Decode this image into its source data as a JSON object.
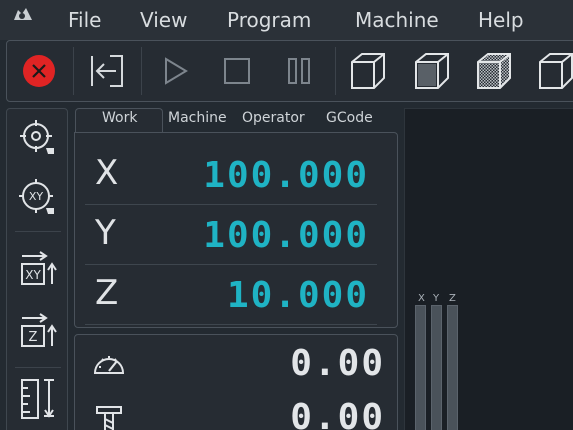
{
  "menu": {
    "items": [
      {
        "label": "File"
      },
      {
        "label": "View"
      },
      {
        "label": "Program"
      },
      {
        "label": "Machine"
      },
      {
        "label": "Help"
      }
    ]
  },
  "toolbar": {
    "buttons": [
      {
        "icon": "estop-icon"
      },
      {
        "icon": "exit-icon"
      },
      {
        "icon": "play-icon"
      },
      {
        "icon": "stop-icon"
      },
      {
        "icon": "pause-icon"
      },
      {
        "icon": "view-cube-icon"
      },
      {
        "icon": "view-cube-front-icon"
      },
      {
        "icon": "view-cube-shaded-icon"
      },
      {
        "icon": "view-cube-side-icon"
      }
    ],
    "estop_color": "#e02424"
  },
  "left_toolbar": {
    "buttons": [
      {
        "icon": "touch-off-probe-icon"
      },
      {
        "icon": "xy-probe-icon",
        "text": "XY"
      },
      {
        "icon": "zero-xy-icon",
        "text": "XY"
      },
      {
        "icon": "zero-z-icon",
        "text": "Z"
      },
      {
        "icon": "tool-length-icon"
      }
    ]
  },
  "dro": {
    "tabs": [
      {
        "label": "Work",
        "active": true
      },
      {
        "label": "Machine"
      },
      {
        "label": "Operator"
      },
      {
        "label": "GCode"
      }
    ],
    "axes": [
      {
        "label": "X",
        "value": "100.000"
      },
      {
        "label": "Y",
        "value": "100.000"
      },
      {
        "label": "Z",
        "value": "10.000"
      }
    ],
    "value_color": "#1fb3c4"
  },
  "status": {
    "feed": {
      "icon": "speedometer-icon",
      "value": "0.00"
    },
    "spindle": {
      "icon": "spindle-icon",
      "value": "0.00"
    }
  },
  "viewport": {
    "bar_labels": [
      "X",
      "Y",
      "Z"
    ]
  }
}
